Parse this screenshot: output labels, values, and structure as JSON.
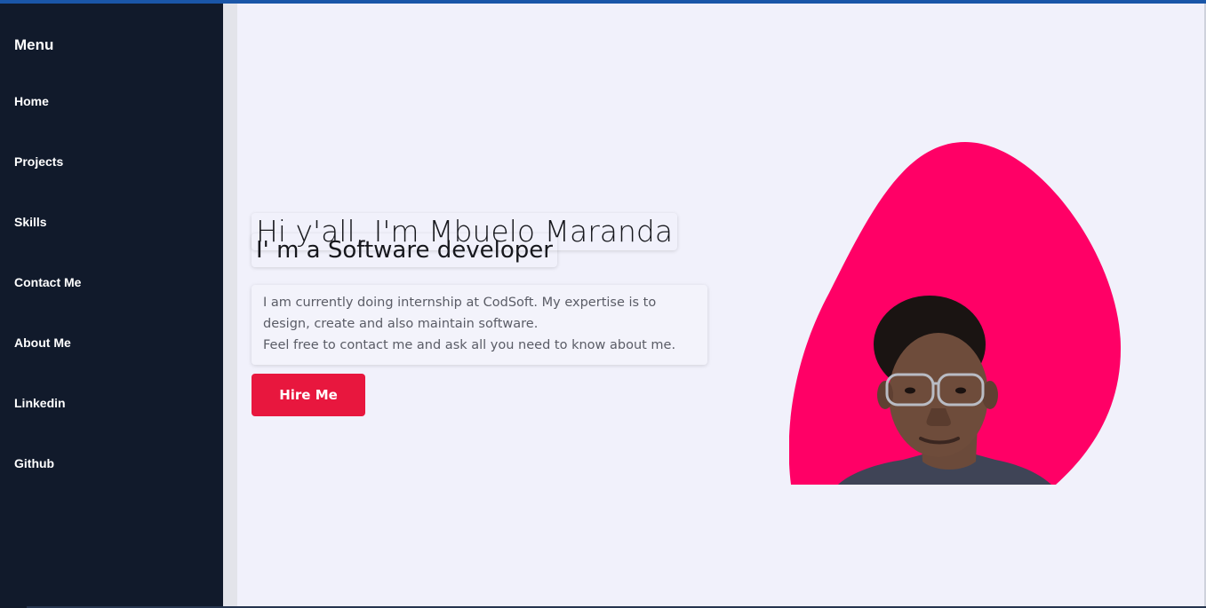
{
  "sidebar": {
    "title": "Menu",
    "items": [
      {
        "label": "Home"
      },
      {
        "label": "Projects"
      },
      {
        "label": "Skills"
      },
      {
        "label": "Contact Me"
      },
      {
        "label": "About Me"
      },
      {
        "label": "Linkedin"
      },
      {
        "label": "Github"
      }
    ]
  },
  "hero": {
    "greeting": "Hi y'all, I'm Mbuelo Maranda",
    "role": "I' m a Software developer",
    "bio_line1": "I am currently doing internship at CodSoft. My expertise is to design, create and also maintain software.",
    "bio_line2": "Feel free to contact me and ask all you need to know about me.",
    "cta_label": "Hire Me"
  },
  "colors": {
    "sidebar_bg": "#111a2b",
    "page_bg": "#f1f1fb",
    "accent": "#e8173e",
    "blob": "#ff0066"
  }
}
